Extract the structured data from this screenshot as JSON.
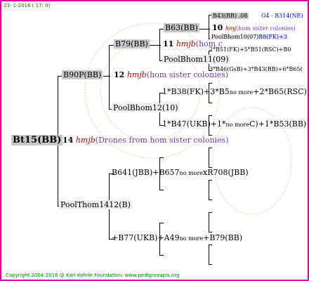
{
  "header_date": "23-  1-2016 ( 17:  0)",
  "footer": "Copyright 2004-2016 @ Karl Kehrle Foundation.   www.pedigreeapis.org",
  "root": {
    "name": "Bt15(BB)",
    "num": "14",
    "hmjb": "hmjb",
    "desc": "(Drones from hom sister colonies)"
  },
  "gen1": {
    "upper": "B90P(BB)",
    "lower": "PoolThom1412(B)",
    "upper_num": "12",
    "upper_hmjb": "hmjb",
    "upper_desc": "(hom sister colonies)"
  },
  "gen2": {
    "b79": "B79(BB)",
    "pool12": "PoolBhom12(10)",
    "b641": "B641(JBB)+B657",
    "b641_more": "no more",
    "b641_tail": "xR708(JBB)",
    "b77": "+B77(UKB)+A49",
    "b77_more": "no more",
    "b77_tail": "+B79(BB)",
    "b79_num": "11",
    "b79_hmjb": "hmjb",
    "b79_desc": "(hom c"
  },
  "gen3": {
    "b63": "B63(BB)",
    "pool11": "PoolBhom11(09)",
    "b38": "1*B38(FK)+3*B5",
    "b38_more": "no more",
    "b38_tail": "+2*B65(RSC)+3*B3",
    "b47": "1*B47(UKB)+1*",
    "b47_more": "no more",
    "b47_tail": "C)+1*B53(BB)+1*",
    "b63_num": "10",
    "b63_hmjb": "hmj",
    "b63_desc": "(hom sister colonies)"
  },
  "gen4": {
    "b43": "B43(BB) .08",
    "g4": "G4 - B314(NE)",
    "pool10": "PoolBhom10(07)",
    "pool10_tail": "B8(FK)+3",
    "b51": "2*B51(FK)+5*B51(RSC)+",
    "b51_tail": "B0",
    "b46": "3*B46(GsB)+3*B43(BB)",
    "b46_tail": "+6*B65("
  }
}
